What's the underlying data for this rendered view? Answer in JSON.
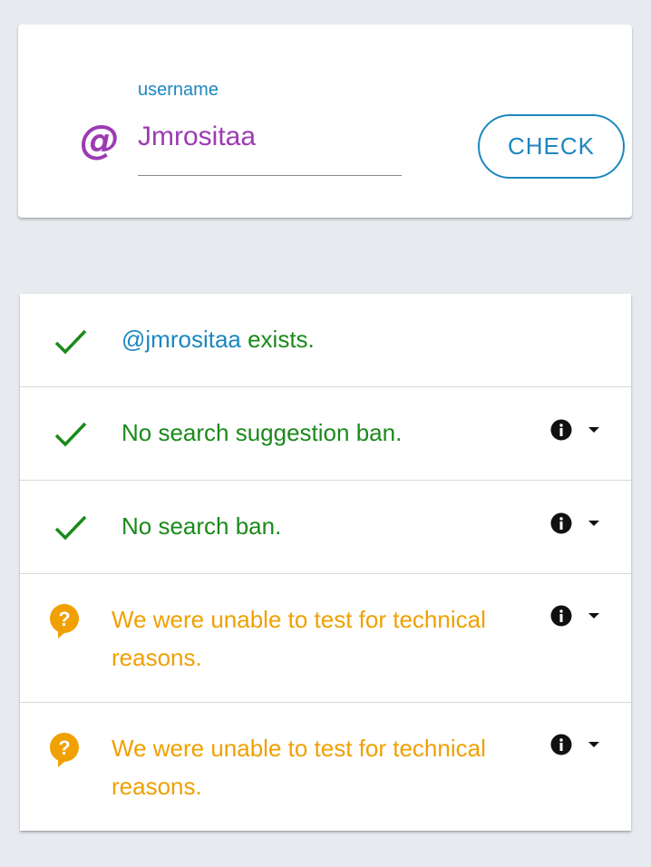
{
  "search": {
    "field_label": "username",
    "at_symbol": "@",
    "username_value": "Jmrositaa",
    "check_button_label": "CHECK"
  },
  "results": {
    "exists": {
      "handle": "@jmrositaa",
      "text": " exists.",
      "status": "check-icon"
    },
    "suggestion_ban": {
      "text": "No search suggestion ban.",
      "status": "check-icon"
    },
    "search_ban": {
      "text": "No search ban.",
      "status": "check-icon"
    },
    "test_1": {
      "text": "We were unable to test for technical reasons.",
      "status": "question-icon"
    },
    "test_2": {
      "text": "We were unable to test for technical reasons.",
      "status": "question-icon"
    }
  },
  "colors": {
    "accent_blue": "#1d87c0",
    "purple": "#9c3bb2",
    "success_green": "#1a8a1a",
    "warning_orange": "#f0a000",
    "background": "#e7ebef"
  }
}
